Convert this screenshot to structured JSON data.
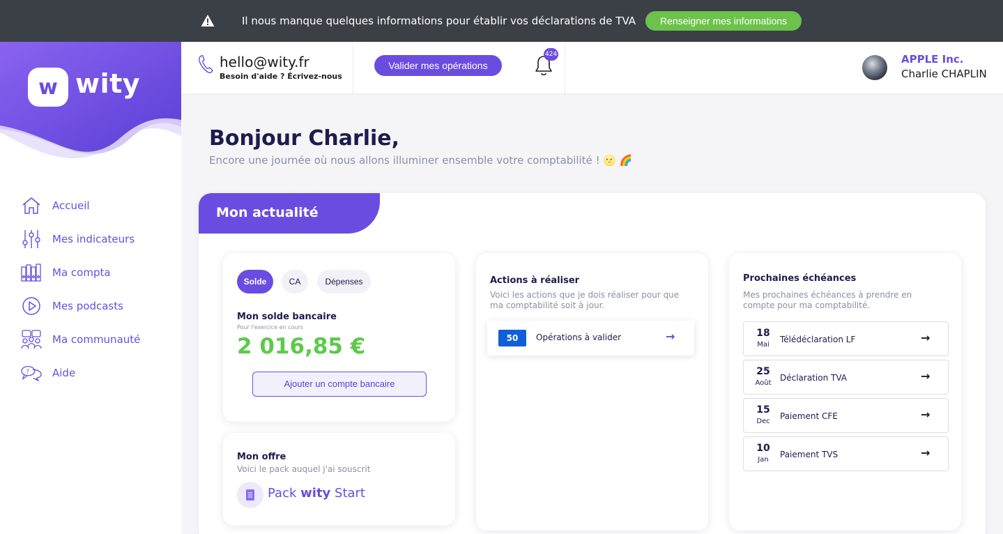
{
  "banner": {
    "message": "Il nous manque quelques informations pour établir vos déclarations de TVA",
    "cta_label": "Renseigner mes informations"
  },
  "brand": {
    "logo_letter": "w",
    "logo_text": "wity"
  },
  "sidebar": {
    "items": [
      {
        "label": "Accueil",
        "icon": "home-icon"
      },
      {
        "label": "Mes indicateurs",
        "icon": "sliders-icon"
      },
      {
        "label": "Ma compta",
        "icon": "binders-icon"
      },
      {
        "label": "Mes podcasts",
        "icon": "play-icon"
      },
      {
        "label": "Ma communauté",
        "icon": "community-icon"
      },
      {
        "label": "Aide",
        "icon": "chat-help-icon"
      }
    ]
  },
  "header": {
    "email": "hello@wity.fr",
    "help_text": "Besoin d'aide ? Écrivez-nous",
    "validate_label": "Valider mes opérations",
    "notification_count": "424",
    "company": "APPLE Inc.",
    "user_name": "Charlie CHAPLIN"
  },
  "greeting": {
    "title": "Bonjour Charlie,",
    "subtitle": "Encore une journée où nous allons illuminer ensemble votre comptabilité ! 🌝 🌈"
  },
  "panel": {
    "title": "Mon actualité"
  },
  "balance_card": {
    "tabs": [
      "Solde",
      "CA",
      "Dépenses"
    ],
    "active_tab": "Solde",
    "title": "Mon solde bancaire",
    "subtitle": "Pour l'exercice en cours",
    "amount": "2 016,85 €",
    "add_bank_label": "Ajouter un compte bancaire"
  },
  "offer_card": {
    "title": "Mon offre",
    "subtitle": "Voici le pack auquel j'ai souscrit",
    "pack_prefix": "Pack",
    "pack_brand": "wity",
    "pack_suffix": "Start"
  },
  "actions_card": {
    "title": "Actions à réaliser",
    "subtitle": "Voici les actions que je dois réaliser pour que ma comptabilité soit à jour.",
    "items": [
      {
        "count": "50",
        "label": "Opérations à valider"
      }
    ]
  },
  "deadlines_card": {
    "title": "Prochaines échéances",
    "subtitle": "Mes prochaines échéances à prendre en compte pour ma comptabilité.",
    "items": [
      {
        "day": "18",
        "month": "Mai",
        "label": "Télédéclaration LF"
      },
      {
        "day": "25",
        "month": "Août",
        "label": "Déclaration TVA"
      },
      {
        "day": "15",
        "month": "Dec",
        "label": "Paiement CFE"
      },
      {
        "day": "10",
        "month": "Jan",
        "label": "Paiement TVS"
      }
    ]
  },
  "colors": {
    "brand": "#6a4de0",
    "banner_bg": "#3b4046",
    "banner_cta": "#6cc24a",
    "balance_positive": "#5ec94b",
    "count_badge": "#0f5fd8"
  }
}
